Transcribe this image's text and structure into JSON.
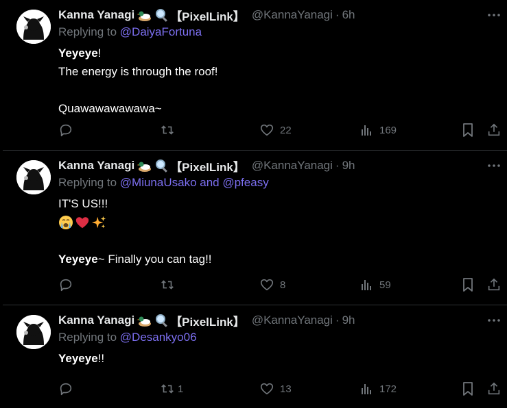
{
  "colors": {
    "background": "#000000",
    "text": "#e7e9ea",
    "muted": "#71767b",
    "link": "#7c6ff0",
    "divider": "#2f3336"
  },
  "tweets": [
    {
      "author_name": "Kanna Yanagi",
      "emojis": [
        "duck-icon",
        "magnifier-icon"
      ],
      "tag": "【PixelLink】",
      "handle": "@KannaYanagi",
      "separator": "·",
      "time": "6h",
      "replying_prefix": "Replying to ",
      "replying_to": "@DaiyaFortuna",
      "replying_to_2": "",
      "body_bold": "Yeyeye",
      "body_after_bold": "!",
      "body_line2": "The energy is through the roof!",
      "body_line3": "",
      "body_line4": "Quawawawawawa~",
      "stats": {
        "replies": "",
        "retweets": "",
        "likes": "22",
        "views": "169"
      }
    },
    {
      "author_name": "Kanna Yanagi",
      "emojis": [
        "duck-icon",
        "magnifier-icon"
      ],
      "tag": "【PixelLink】",
      "handle": "@KannaYanagi",
      "separator": "·",
      "time": "9h",
      "replying_prefix": "Replying to ",
      "replying_to": "@MiunaUsako",
      "replying_joiner": " and ",
      "replying_to_2": "@pfeasy",
      "body_line1": "IT'S US!!!",
      "body_emojis": [
        "crying-face-icon",
        "red-heart-icon",
        "sparkles-icon"
      ],
      "body_line3": "",
      "body_bold": "Yeyeye",
      "body_after_bold": "~ Finally you can tag!!",
      "stats": {
        "replies": "",
        "retweets": "",
        "likes": "8",
        "views": "59"
      }
    },
    {
      "author_name": "Kanna Yanagi",
      "emojis": [
        "duck-icon",
        "magnifier-icon"
      ],
      "tag": "【PixelLink】",
      "handle": "@KannaYanagi",
      "separator": "·",
      "time": "9h",
      "replying_prefix": "Replying to ",
      "replying_to": "@Desankyo06",
      "body_bold": "Yeyeye",
      "body_after_bold": "!!",
      "stats": {
        "replies": "",
        "retweets": "1",
        "likes": "13",
        "views": "172"
      }
    }
  ]
}
